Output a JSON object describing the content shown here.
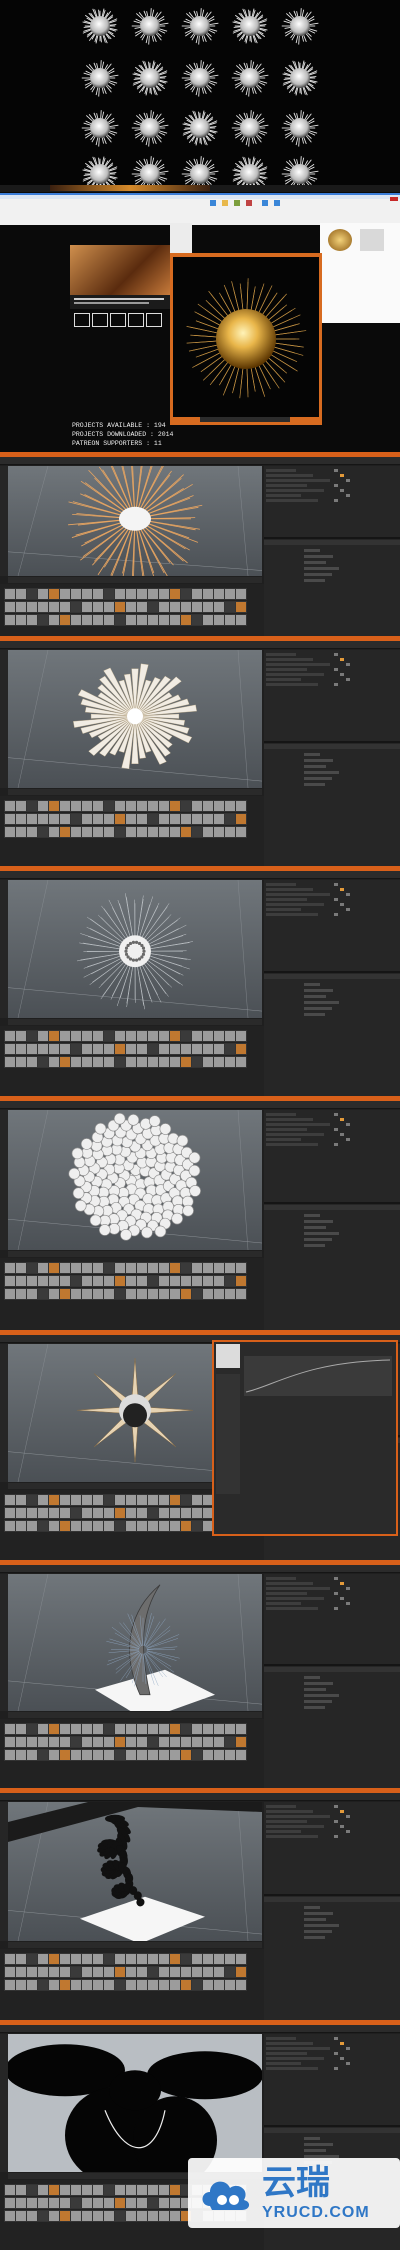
{
  "grid": {
    "rows": 4,
    "cols": 5
  },
  "web_page": {
    "stat_lines": [
      "PROJECTS AVAILABLE : 194",
      "PROJECTS DOWNLOADED : 2014",
      "PATREON SUPPORTERS : 11"
    ]
  },
  "app_windows": [
    {
      "id": "app-1",
      "subject": "spike sphere with gold rays"
    },
    {
      "id": "app-2",
      "subject": "white spiky petal burst"
    },
    {
      "id": "app-3",
      "subject": "small dotted sphere with fine spines"
    },
    {
      "id": "app-4",
      "subject": "bumpy coral sphere"
    },
    {
      "id": "app-5",
      "subject": "spiked orb with graph editor"
    },
    {
      "id": "app-6",
      "subject": "curved tentacle on plane"
    },
    {
      "id": "app-7",
      "subject": "dark coral branch on plane"
    },
    {
      "id": "app-8",
      "subject": "black silhouette flower"
    }
  ],
  "watermark": {
    "chinese": "云瑞",
    "url": "YRUCD.COM"
  },
  "colors": {
    "accent_orange": "#d8601a",
    "viewport_bg": "#5d6368",
    "panel_bg": "#262626",
    "web_blue": "#1b5fb3"
  }
}
